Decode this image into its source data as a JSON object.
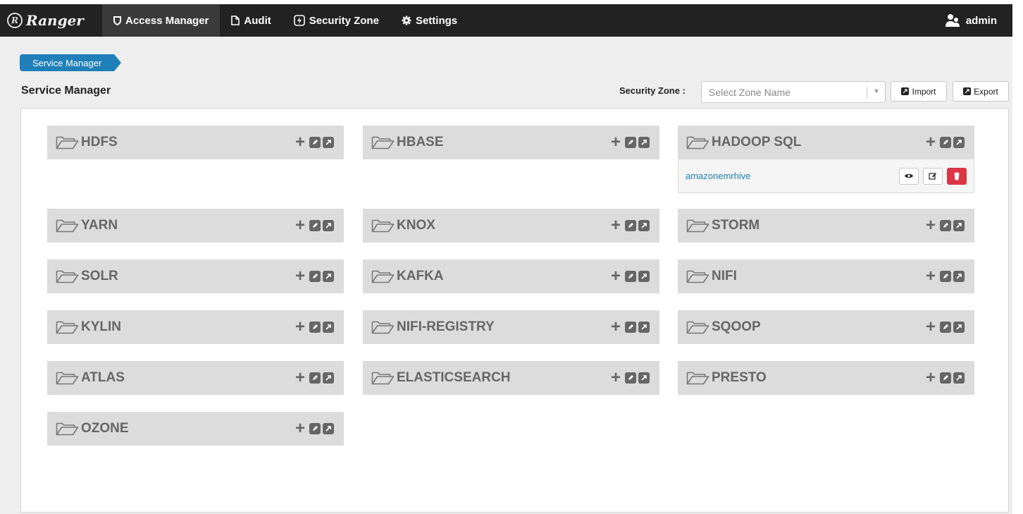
{
  "nav": {
    "brand": "Ranger",
    "brand_logo_glyph": "R",
    "items": [
      {
        "label": "Access Manager",
        "icon": "shield-icon",
        "active": true
      },
      {
        "label": "Audit",
        "icon": "file-icon",
        "active": false
      },
      {
        "label": "Security Zone",
        "icon": "bolt-icon",
        "active": false
      },
      {
        "label": "Settings",
        "icon": "gear-icon",
        "active": false
      }
    ],
    "user": "admin"
  },
  "breadcrumb": "Service Manager",
  "page_title": "Service Manager",
  "toolbar": {
    "zone_label": "Security Zone :",
    "zone_placeholder": "Select Zone Name",
    "import_label": "Import",
    "export_label": "Export"
  },
  "services": [
    {
      "name": "HDFS",
      "items": []
    },
    {
      "name": "HBASE",
      "items": []
    },
    {
      "name": "HADOOP SQL",
      "items": [
        "amazonemrhive"
      ]
    },
    {
      "name": "YARN",
      "items": []
    },
    {
      "name": "KNOX",
      "items": []
    },
    {
      "name": "STORM",
      "items": []
    },
    {
      "name": "SOLR",
      "items": []
    },
    {
      "name": "KAFKA",
      "items": []
    },
    {
      "name": "NIFI",
      "items": []
    },
    {
      "name": "KYLIN",
      "items": []
    },
    {
      "name": "NIFI-REGISTRY",
      "items": []
    },
    {
      "name": "SQOOP",
      "items": []
    },
    {
      "name": "ATLAS",
      "items": []
    },
    {
      "name": "ELASTICSEARCH",
      "items": []
    },
    {
      "name": "PRESTO",
      "items": []
    },
    {
      "name": "OZONE",
      "items": []
    }
  ],
  "colors": {
    "navbar": "#222222",
    "accent": "#1f7fb8",
    "danger": "#dc3545",
    "service_header": "#dcdcdc"
  }
}
